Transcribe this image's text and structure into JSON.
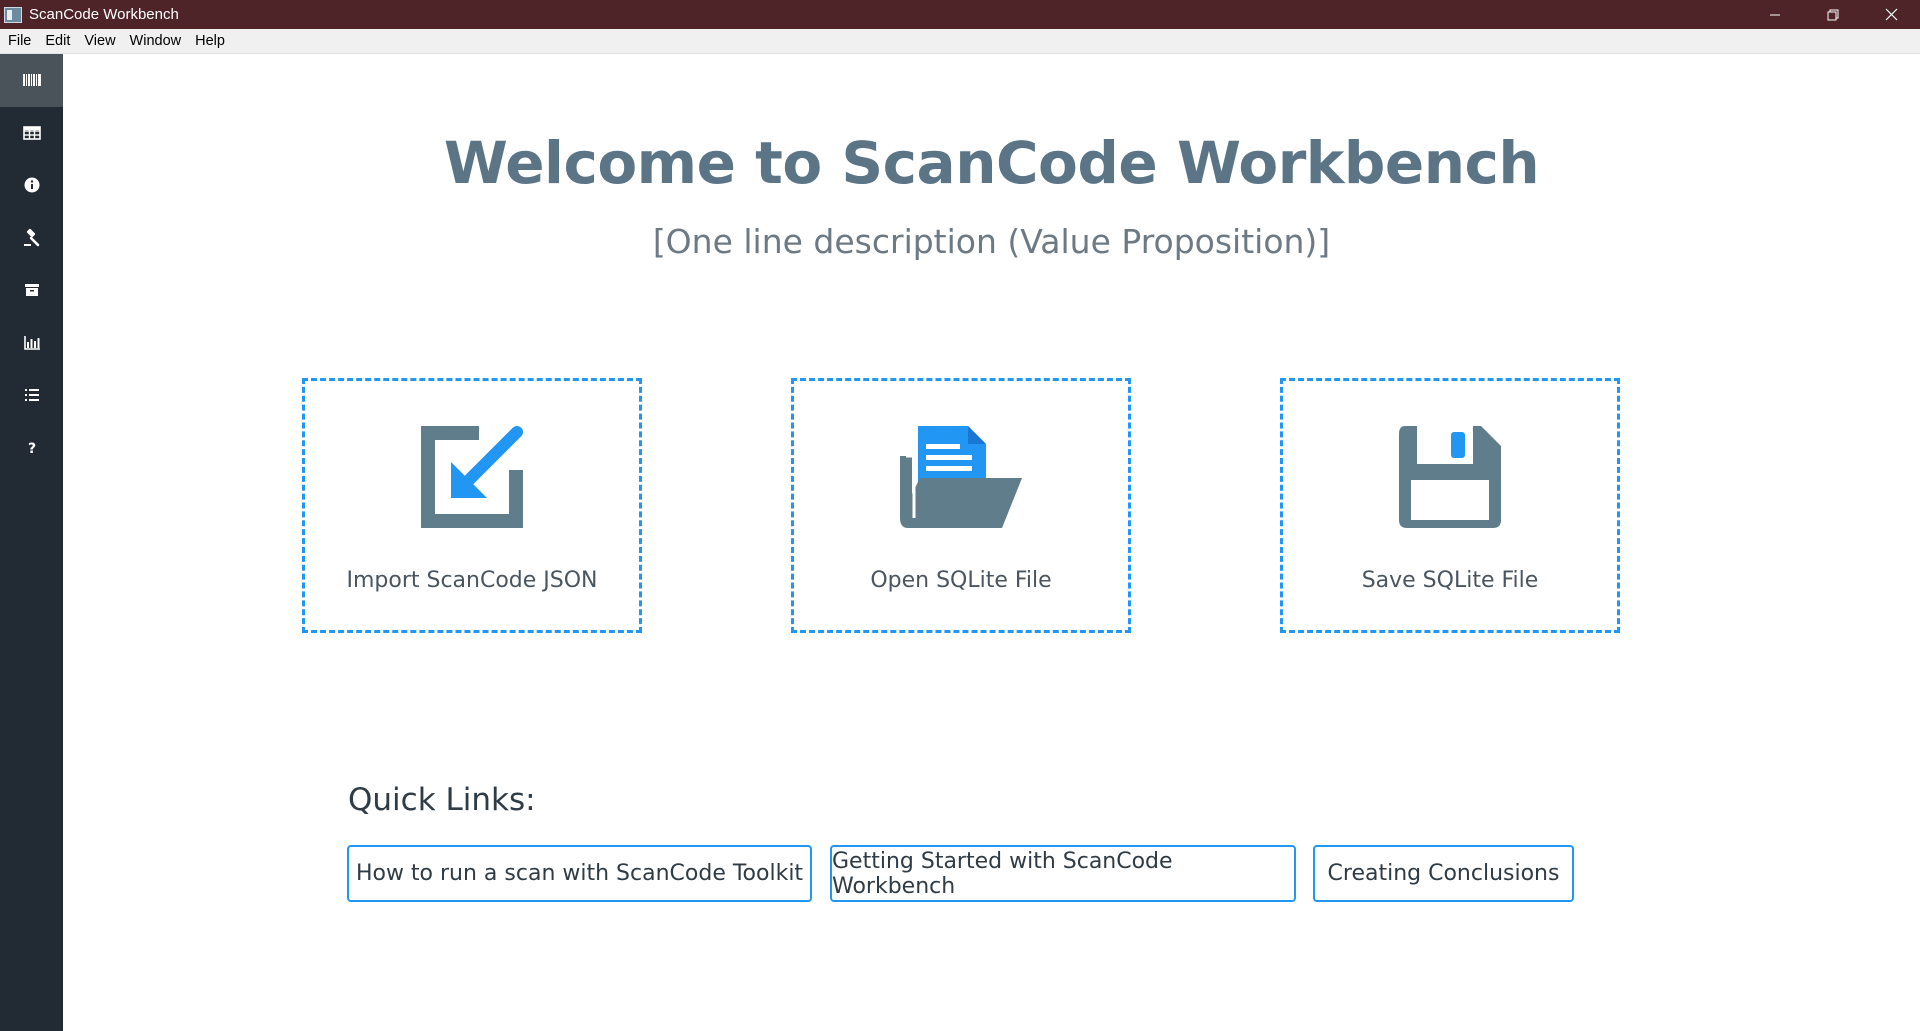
{
  "window": {
    "title": "ScanCode Workbench",
    "controls": {
      "minimize": "—",
      "restore": "❐",
      "close": "✕"
    }
  },
  "menubar": {
    "items": [
      "File",
      "Edit",
      "View",
      "Window",
      "Help"
    ]
  },
  "sidebar": {
    "items": [
      {
        "icon": "barcode-icon",
        "active": true
      },
      {
        "icon": "table-icon",
        "active": false
      },
      {
        "icon": "info-icon",
        "active": false
      },
      {
        "icon": "gavel-icon",
        "active": false
      },
      {
        "icon": "archive-icon",
        "active": false
      },
      {
        "icon": "bar-chart-icon",
        "active": false
      },
      {
        "icon": "list-icon",
        "active": false
      },
      {
        "icon": "question-icon",
        "active": false
      }
    ]
  },
  "main": {
    "heading": "Welcome to ScanCode Workbench",
    "subheading": "[One line description (Value Proposition)]",
    "actions": [
      {
        "label": "Import ScanCode JSON",
        "icon": "import-icon"
      },
      {
        "label": "Open SQLite File",
        "icon": "open-folder-icon"
      },
      {
        "label": "Save SQLite File",
        "icon": "save-icon"
      }
    ],
    "quick_links": {
      "title": "Quick Links:",
      "links": [
        "How to run a scan with ScanCode Toolkit",
        "Getting Started with ScanCode Workbench",
        "Creating Conclusions"
      ]
    }
  },
  "colors": {
    "titlebar": "#4e2429",
    "sidebar": "#222b33",
    "accent": "#2196f3",
    "heading": "#5b7587",
    "icon": "#607d8b"
  }
}
